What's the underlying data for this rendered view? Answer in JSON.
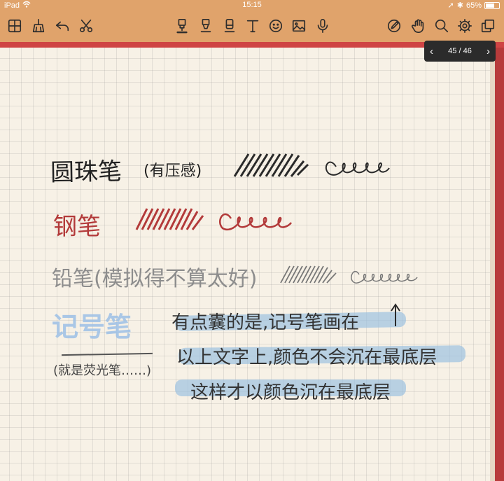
{
  "status": {
    "device": "iPad",
    "time": "15:15",
    "battery": "65%",
    "battery_level": 0.65
  },
  "toolbar": {
    "left": [
      {
        "name": "grid-view",
        "icon": "grid-icon"
      },
      {
        "name": "broom",
        "icon": "broom-icon"
      },
      {
        "name": "undo",
        "icon": "undo-icon"
      },
      {
        "name": "cut",
        "icon": "scissors-icon"
      }
    ],
    "center": [
      {
        "name": "pen-tool",
        "icon": "pen-icon"
      },
      {
        "name": "highlighter-tool",
        "icon": "highlighter-icon"
      },
      {
        "name": "eraser-tool",
        "icon": "eraser-icon"
      },
      {
        "name": "text-tool",
        "icon": "text-icon"
      },
      {
        "name": "sticker-tool",
        "icon": "smiley-icon"
      },
      {
        "name": "image-tool",
        "icon": "image-icon"
      },
      {
        "name": "voice-tool",
        "icon": "microphone-icon"
      }
    ],
    "right": [
      {
        "name": "pencil-slash",
        "icon": "pencil-slash-icon"
      },
      {
        "name": "hand-tool",
        "icon": "hand-icon"
      },
      {
        "name": "search",
        "icon": "search-icon"
      },
      {
        "name": "settings",
        "icon": "gear-icon"
      },
      {
        "name": "pages",
        "icon": "copy-icon"
      }
    ]
  },
  "page_nav": {
    "label": "45 / 46",
    "prev": "‹",
    "next": "›"
  },
  "note": {
    "pen_label": "圆珠笔",
    "pen_note": "(有压感)",
    "fountain_label": "钢笔",
    "pencil_label": "铅笔(模拟得不算太好)",
    "highlighter_label": "记号笔",
    "highlighter_note": "(就是荧光笔……)",
    "remark_1": "有点囊的是,记号笔画在",
    "remark_2": "以上文字上,颜色不会沉在最底层",
    "remark_3": "这样才以颜色沉在最底层"
  },
  "colors": {
    "toolbar_bg": "#e0a36b",
    "ballpoint": "#222222",
    "fountain": "#b33a3a",
    "pencil": "#8d8d8d",
    "highlighter": "#9dc0e6",
    "page_bg": "#f7f1e6",
    "red_cover": "#cf4444"
  }
}
